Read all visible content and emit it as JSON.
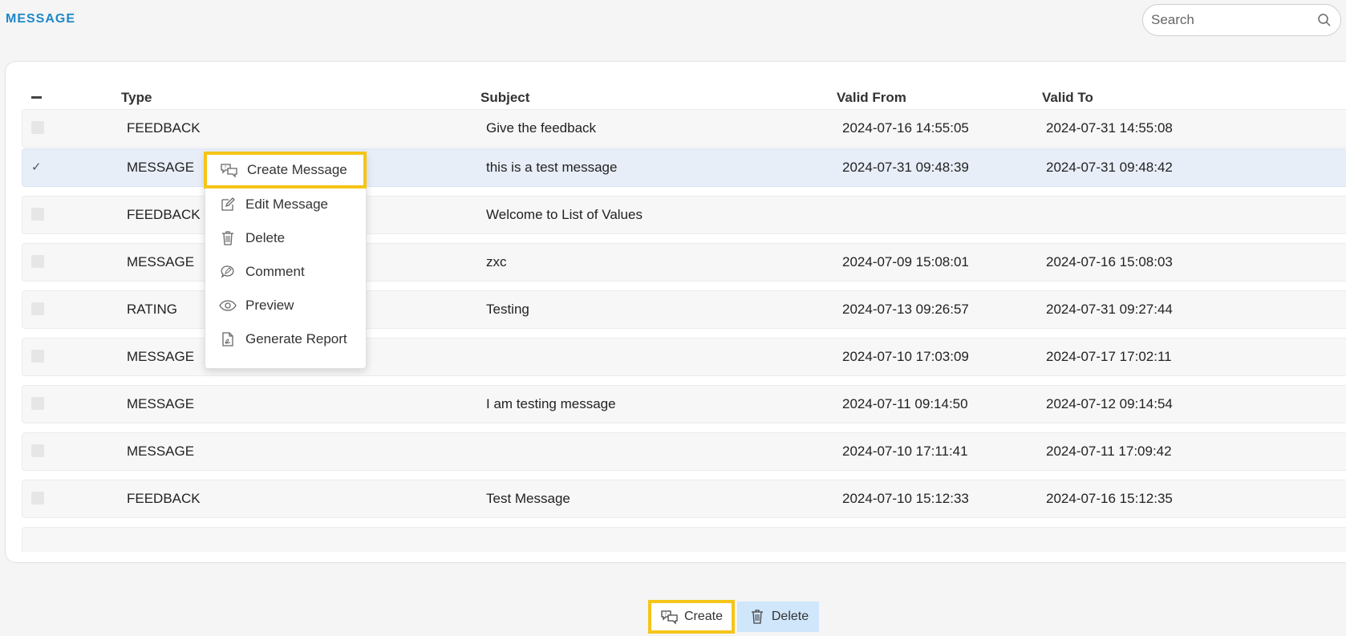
{
  "header": {
    "title": "MESSAGE",
    "search_placeholder": "Search"
  },
  "table": {
    "columns": {
      "type": "Type",
      "subject": "Subject",
      "valid_from": "Valid From",
      "valid_to": "Valid To"
    },
    "rows": [
      {
        "type": "FEEDBACK",
        "subject": "Give the feedback",
        "valid_from": "2024-07-16 14:55:05",
        "valid_to": "2024-07-31 14:55:08",
        "checked": false
      },
      {
        "type": "MESSAGE",
        "subject": "this is a test message",
        "valid_from": "2024-07-31 09:48:39",
        "valid_to": "2024-07-31 09:48:42",
        "checked": true
      },
      {
        "type": "FEEDBACK",
        "subject": "Welcome to List of Values",
        "valid_from": "",
        "valid_to": "",
        "checked": false
      },
      {
        "type": "MESSAGE",
        "subject": "zxc",
        "valid_from": "2024-07-09 15:08:01",
        "valid_to": "2024-07-16 15:08:03",
        "checked": false
      },
      {
        "type": "RATING",
        "subject": "Testing",
        "valid_from": "2024-07-13 09:26:57",
        "valid_to": "2024-07-31 09:27:44",
        "checked": false
      },
      {
        "type": "MESSAGE",
        "subject": "",
        "valid_from": "2024-07-10 17:03:09",
        "valid_to": "2024-07-17 17:02:11",
        "checked": false
      },
      {
        "type": "MESSAGE",
        "subject": "I am testing message",
        "valid_from": "2024-07-11 09:14:50",
        "valid_to": "2024-07-12 09:14:54",
        "checked": false
      },
      {
        "type": "MESSAGE",
        "subject": "",
        "valid_from": "2024-07-10 17:11:41",
        "valid_to": "2024-07-11 17:09:42",
        "checked": false
      },
      {
        "type": "FEEDBACK",
        "subject": "Test Message",
        "valid_from": "2024-07-10 15:12:33",
        "valid_to": "2024-07-16 15:12:35",
        "checked": false
      }
    ]
  },
  "context_menu": {
    "items": [
      {
        "label": "Create Message",
        "icon": "chat-bubbles-icon"
      },
      {
        "label": "Edit Message",
        "icon": "edit-icon"
      },
      {
        "label": "Delete",
        "icon": "trash-icon"
      },
      {
        "label": "Comment",
        "icon": "comment-icon"
      },
      {
        "label": "Preview",
        "icon": "eye-icon"
      },
      {
        "label": "Generate Report",
        "icon": "report-icon"
      }
    ]
  },
  "footer": {
    "create_label": "Create",
    "delete_label": "Delete"
  },
  "colors": {
    "accent": "#1e88c8",
    "highlight": "#f5c518",
    "selected_row": "#e8eef8",
    "delete_button": "#cfe6fb"
  }
}
